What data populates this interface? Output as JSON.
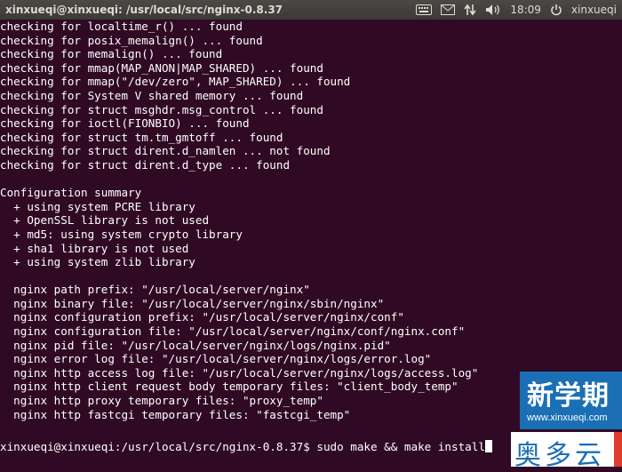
{
  "topbar": {
    "title": "xinxueqi@xinxueqi: /usr/local/src/nginx-0.8.37",
    "indicators": {
      "keyboard_icon": "keyboard-icon",
      "mail_icon": "mail-icon",
      "network_icon": "network-arrows-icon",
      "volume_icon": "volume-icon",
      "clock": "18:09",
      "power_icon": "power-icon",
      "user": "xinxueqi"
    }
  },
  "terminal": {
    "lines": [
      "checking for localtime_r() ... found",
      "checking for posix_memalign() ... found",
      "checking for memalign() ... found",
      "checking for mmap(MAP_ANON|MAP_SHARED) ... found",
      "checking for mmap(\"/dev/zero\", MAP_SHARED) ... found",
      "checking for System V shared memory ... found",
      "checking for struct msghdr.msg_control ... found",
      "checking for ioctl(FIONBIO) ... found",
      "checking for struct tm.tm_gmtoff ... found",
      "checking for struct dirent.d_namlen ... not found",
      "checking for struct dirent.d_type ... found",
      "",
      "Configuration summary",
      "  + using system PCRE library",
      "  + OpenSSL library is not used",
      "  + md5: using system crypto library",
      "  + sha1 library is not used",
      "  + using system zlib library",
      "",
      "  nginx path prefix: \"/usr/local/server/nginx\"",
      "  nginx binary file: \"/usr/local/server/nginx/sbin/nginx\"",
      "  nginx configuration prefix: \"/usr/local/server/nginx/conf\"",
      "  nginx configuration file: \"/usr/local/server/nginx/conf/nginx.conf\"",
      "  nginx pid file: \"/usr/local/server/nginx/logs/nginx.pid\"",
      "  nginx error log file: \"/usr/local/server/nginx/logs/error.log\"",
      "  nginx http access log file: \"/usr/local/server/nginx/logs/access.log\"",
      "  nginx http client request body temporary files: \"client_body_temp\"",
      "  nginx http proxy temporary files: \"proxy_temp\"",
      "  nginx http fastcgi temporary files: \"fastcgi_temp\""
    ],
    "prompt": "xinxueqi@xinxueqi:/usr/local/src/nginx-0.8.37$ sudo make && make install"
  },
  "watermark": {
    "brand": "新学期",
    "url": "www.xinxueqi.com",
    "sub": "奥多云"
  },
  "colors": {
    "terminal_bg": "#300a24",
    "terminal_fg": "#ffffff",
    "panel_bg": "#3c3b37",
    "watermark_blue": "#1a6fb5"
  }
}
